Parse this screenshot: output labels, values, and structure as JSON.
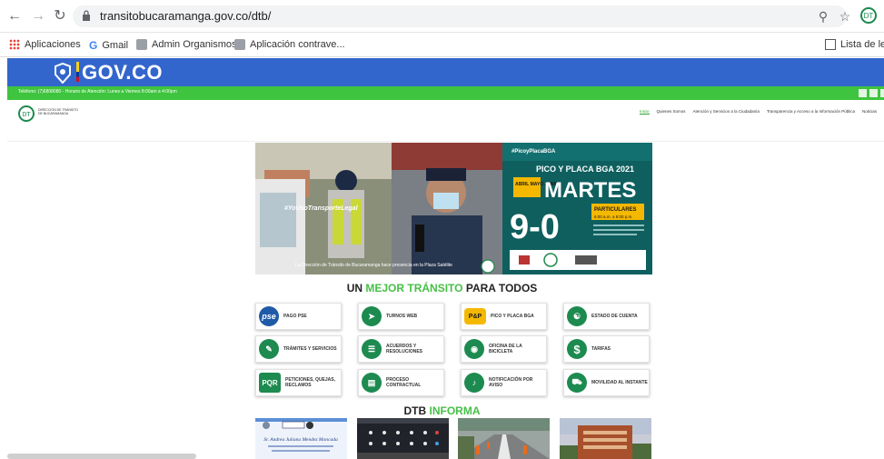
{
  "browser": {
    "url": "transitobucaramanga.gov.co/dtb/",
    "bookmarks": [
      {
        "label": "Aplicaciones"
      },
      {
        "label": "Gmail"
      },
      {
        "label": "Admin Organismos..."
      },
      {
        "label": "Aplicación contrave..."
      }
    ],
    "reading_list": "Lista de lec"
  },
  "gov": {
    "title": "GOV.CO"
  },
  "topbar": {
    "text": "Teléfono: (7)6808080 - Horario de Atención: Lunes a Viernes 8:00am a 4:00pm"
  },
  "header": {
    "logo_text": "DIRECCIÓN DE TRÁNSITO DE BUCARAMANGA",
    "menu": [
      "Inicio",
      "Quienes Somos",
      "Atención y Servicios a la Ciudadanía",
      "Transparencia y Acceso a la Información Pública",
      "Noticias"
    ]
  },
  "hero": {
    "hashtag": "#YoUsoTransporteLegal",
    "caption": "La Dirección de Tránsito de Bucaramanga hace presencia en la Plaza Satélite",
    "pico_tag": "#PicoyPlacaBGA",
    "pico_title": "PICO Y PLACA BGA 2021",
    "pico_months": "ABRIL MAYO JUNIO",
    "pico_day": "MARTES",
    "pico_digits": "9-0",
    "pico_type": "PARTICULARES",
    "pico_time": "6:00 a.m. a 8:00 p.m."
  },
  "headline": {
    "pre": "UN ",
    "mid": "MEJOR TRÁNSITO",
    "post": " PARA TODOS"
  },
  "services": [
    {
      "label": "PAGO PSE",
      "icon": "PSE"
    },
    {
      "label": "TURNOS WEB",
      "icon": "rocket"
    },
    {
      "label": "PICO Y PLACA BGA",
      "icon": "P&P"
    },
    {
      "label": "ESTADO DE CUENTA",
      "icon": "account"
    },
    {
      "label": "TRÁMITES Y SERVICIOS",
      "icon": "doc"
    },
    {
      "label": "ACUERDOS Y RESOLUCIONES",
      "icon": "docs"
    },
    {
      "label": "OFICINA DE LA BICICLETA",
      "icon": "bike"
    },
    {
      "label": "TARIFAS",
      "icon": "$"
    },
    {
      "label": "PETICIONES, QUEJAS, RECLAMOS",
      "icon": "PQR"
    },
    {
      "label": "PROCESO CONTRACTUAL",
      "icon": "contract"
    },
    {
      "label": "NOTIFICACIÓN POR AVISO",
      "icon": "bell"
    },
    {
      "label": "MOVILIDAD AL INSTANTE",
      "icon": "car"
    }
  ],
  "informa": {
    "pre": "DTB ",
    "post": "INFORMA"
  },
  "news_thumbs": [
    {
      "name": "Sr. Andrea Juliana Mendez Moncada"
    },
    {
      "name": "thumb-2"
    },
    {
      "name": "thumb-3"
    },
    {
      "name": "thumb-4"
    }
  ],
  "colors": {
    "gov_blue": "#3366cc",
    "green": "#3ec43e",
    "brand_green": "#1d8a4f"
  }
}
